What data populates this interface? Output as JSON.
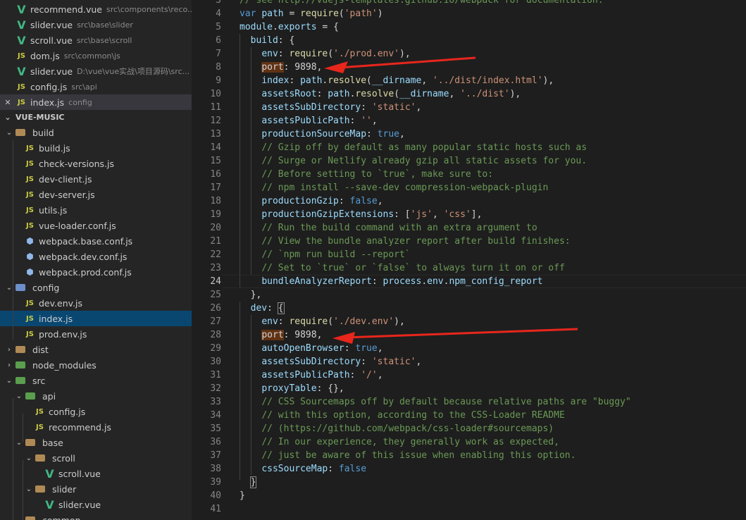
{
  "open_editors": [
    {
      "name": "recommend.vue",
      "path": "src\\components\\reco...",
      "type": "vue"
    },
    {
      "name": "slider.vue",
      "path": "src\\base\\slider",
      "type": "vue"
    },
    {
      "name": "scroll.vue",
      "path": "src\\base\\scroll",
      "type": "vue"
    },
    {
      "name": "dom.js",
      "path": "src\\common\\js",
      "type": "js"
    },
    {
      "name": "slider.vue",
      "path": "D:\\vue\\vue实战\\项目源码\\src...",
      "type": "vue"
    },
    {
      "name": "config.js",
      "path": "src\\api",
      "type": "js"
    },
    {
      "name": "index.js",
      "path": "config",
      "type": "js",
      "close": "✕",
      "selected": true
    }
  ],
  "project": {
    "title": "VUE-MUSIC",
    "chevron": "⌄"
  },
  "tree": [
    {
      "name": "build",
      "type": "folder",
      "depth": 0,
      "expanded": true,
      "color": "tan"
    },
    {
      "name": "build.js",
      "type": "js",
      "depth": 1
    },
    {
      "name": "check-versions.js",
      "type": "js",
      "depth": 1
    },
    {
      "name": "dev-client.js",
      "type": "js",
      "depth": 1
    },
    {
      "name": "dev-server.js",
      "type": "js",
      "depth": 1
    },
    {
      "name": "utils.js",
      "type": "js",
      "depth": 1
    },
    {
      "name": "vue-loader.conf.js",
      "type": "js",
      "depth": 1
    },
    {
      "name": "webpack.base.conf.js",
      "type": "webpack",
      "depth": 1
    },
    {
      "name": "webpack.dev.conf.js",
      "type": "webpack",
      "depth": 1
    },
    {
      "name": "webpack.prod.conf.js",
      "type": "webpack",
      "depth": 1
    },
    {
      "name": "config",
      "type": "folder",
      "depth": 0,
      "expanded": true,
      "color": "blue"
    },
    {
      "name": "dev.env.js",
      "type": "js",
      "depth": 1
    },
    {
      "name": "index.js",
      "type": "js",
      "depth": 1,
      "selected": true
    },
    {
      "name": "prod.env.js",
      "type": "js",
      "depth": 1
    },
    {
      "name": "dist",
      "type": "folder",
      "depth": 0,
      "expanded": false,
      "color": "tan"
    },
    {
      "name": "node_modules",
      "type": "folder",
      "depth": 0,
      "expanded": false,
      "color": "green"
    },
    {
      "name": "src",
      "type": "folder",
      "depth": 0,
      "expanded": true,
      "color": "green"
    },
    {
      "name": "api",
      "type": "folder",
      "depth": 1,
      "expanded": true,
      "color": "green"
    },
    {
      "name": "config.js",
      "type": "js",
      "depth": 2
    },
    {
      "name": "recommend.js",
      "type": "js",
      "depth": 2
    },
    {
      "name": "base",
      "type": "folder",
      "depth": 1,
      "expanded": true,
      "color": "tan"
    },
    {
      "name": "scroll",
      "type": "folder",
      "depth": 2,
      "expanded": true,
      "color": "tan"
    },
    {
      "name": "scroll.vue",
      "type": "vue",
      "depth": 3
    },
    {
      "name": "slider",
      "type": "folder",
      "depth": 2,
      "expanded": true,
      "color": "tan"
    },
    {
      "name": "slider.vue",
      "type": "vue",
      "depth": 3
    },
    {
      "name": "common",
      "type": "folder",
      "depth": 1,
      "expanded": true,
      "color": "tan"
    }
  ],
  "icons": {
    "js": "JS",
    "vue": "V",
    "webpack": "⬢",
    "folder_open": "⌄",
    "folder_closed": "›"
  },
  "code": {
    "first_line": 3,
    "active_line": 24,
    "lines": [
      [
        [
          "c",
          "// see http://vuejs-templates.github.io/webpack for documentation."
        ]
      ],
      [
        [
          "k",
          "var"
        ],
        [
          "t",
          " "
        ],
        [
          "p",
          "path"
        ],
        [
          "t",
          " = "
        ],
        [
          "f",
          "require"
        ],
        [
          "t",
          "("
        ],
        [
          "s",
          "'path'"
        ],
        [
          "t",
          ")"
        ]
      ],
      [
        [
          "p",
          "module"
        ],
        [
          "t",
          "."
        ],
        [
          "p",
          "exports"
        ],
        [
          "t",
          " = {"
        ]
      ],
      [
        [
          "t",
          "  "
        ],
        [
          "p",
          "build"
        ],
        [
          "t",
          ": {"
        ]
      ],
      [
        [
          "t",
          "    "
        ],
        [
          "p",
          "env"
        ],
        [
          "t",
          ": "
        ],
        [
          "f",
          "require"
        ],
        [
          "t",
          "("
        ],
        [
          "s",
          "'./prod.env'"
        ],
        [
          "t",
          "),"
        ]
      ],
      [
        [
          "t",
          "    "
        ],
        [
          "port",
          "port"
        ],
        [
          "t",
          ": 9898,"
        ]
      ],
      [
        [
          "t",
          "    "
        ],
        [
          "p",
          "index"
        ],
        [
          "t",
          ": "
        ],
        [
          "p",
          "path"
        ],
        [
          "t",
          "."
        ],
        [
          "f",
          "resolve"
        ],
        [
          "t",
          "("
        ],
        [
          "p",
          "__dirname"
        ],
        [
          "t",
          ", "
        ],
        [
          "s",
          "'../dist/index.html'"
        ],
        [
          "t",
          "),"
        ]
      ],
      [
        [
          "t",
          "    "
        ],
        [
          "p",
          "assetsRoot"
        ],
        [
          "t",
          ": "
        ],
        [
          "p",
          "path"
        ],
        [
          "t",
          "."
        ],
        [
          "f",
          "resolve"
        ],
        [
          "t",
          "("
        ],
        [
          "p",
          "__dirname"
        ],
        [
          "t",
          ", "
        ],
        [
          "s",
          "'../dist'"
        ],
        [
          "t",
          "),"
        ]
      ],
      [
        [
          "t",
          "    "
        ],
        [
          "p",
          "assetsSubDirectory"
        ],
        [
          "t",
          ": "
        ],
        [
          "s",
          "'static'"
        ],
        [
          "t",
          ","
        ]
      ],
      [
        [
          "t",
          "    "
        ],
        [
          "p",
          "assetsPublicPath"
        ],
        [
          "t",
          ": "
        ],
        [
          "s",
          "''"
        ],
        [
          "t",
          ","
        ]
      ],
      [
        [
          "t",
          "    "
        ],
        [
          "p",
          "productionSourceMap"
        ],
        [
          "t",
          ": "
        ],
        [
          "b",
          "true"
        ],
        [
          "t",
          ","
        ]
      ],
      [
        [
          "t",
          "    "
        ],
        [
          "c",
          "// Gzip off by default as many popular static hosts such as"
        ]
      ],
      [
        [
          "t",
          "    "
        ],
        [
          "c",
          "// Surge or Netlify already gzip all static assets for you."
        ]
      ],
      [
        [
          "t",
          "    "
        ],
        [
          "c",
          "// Before setting to `true`, make sure to:"
        ]
      ],
      [
        [
          "t",
          "    "
        ],
        [
          "c",
          "// npm install --save-dev compression-webpack-plugin"
        ]
      ],
      [
        [
          "t",
          "    "
        ],
        [
          "p",
          "productionGzip"
        ],
        [
          "t",
          ": "
        ],
        [
          "b",
          "false"
        ],
        [
          "t",
          ","
        ]
      ],
      [
        [
          "t",
          "    "
        ],
        [
          "p",
          "productionGzipExtensions"
        ],
        [
          "t",
          ": ["
        ],
        [
          "s",
          "'js'"
        ],
        [
          "t",
          ", "
        ],
        [
          "s",
          "'css'"
        ],
        [
          "t",
          "],"
        ]
      ],
      [
        [
          "t",
          "    "
        ],
        [
          "c",
          "// Run the build command with an extra argument to"
        ]
      ],
      [
        [
          "t",
          "    "
        ],
        [
          "c",
          "// View the bundle analyzer report after build finishes:"
        ]
      ],
      [
        [
          "t",
          "    "
        ],
        [
          "c",
          "// `npm run build --report`"
        ]
      ],
      [
        [
          "t",
          "    "
        ],
        [
          "c",
          "// Set to `true` or `false` to always turn it on or off"
        ]
      ],
      [
        [
          "t",
          "    "
        ],
        [
          "p",
          "bundleAnalyzerReport"
        ],
        [
          "t",
          ": "
        ],
        [
          "p",
          "process"
        ],
        [
          "t",
          "."
        ],
        [
          "p",
          "env"
        ],
        [
          "t",
          "."
        ],
        [
          "p",
          "npm_config_report"
        ]
      ],
      [
        [
          "t",
          "  },"
        ]
      ],
      [
        [
          "t",
          "  "
        ],
        [
          "p",
          "dev"
        ],
        [
          "t",
          ": "
        ],
        [
          "brk",
          "{"
        ]
      ],
      [
        [
          "t",
          "    "
        ],
        [
          "p",
          "env"
        ],
        [
          "t",
          ": "
        ],
        [
          "f",
          "require"
        ],
        [
          "t",
          "("
        ],
        [
          "s",
          "'./dev.env'"
        ],
        [
          "t",
          "),"
        ]
      ],
      [
        [
          "t",
          "    "
        ],
        [
          "port",
          "port"
        ],
        [
          "t",
          ": 9898,"
        ]
      ],
      [
        [
          "t",
          "    "
        ],
        [
          "p",
          "autoOpenBrowser"
        ],
        [
          "t",
          ": "
        ],
        [
          "b",
          "true"
        ],
        [
          "t",
          ","
        ]
      ],
      [
        [
          "t",
          "    "
        ],
        [
          "p",
          "assetsSubDirectory"
        ],
        [
          "t",
          ": "
        ],
        [
          "s",
          "'static'"
        ],
        [
          "t",
          ","
        ]
      ],
      [
        [
          "t",
          "    "
        ],
        [
          "p",
          "assetsPublicPath"
        ],
        [
          "t",
          ": "
        ],
        [
          "s",
          "'/'"
        ],
        [
          "t",
          ","
        ]
      ],
      [
        [
          "t",
          "    "
        ],
        [
          "p",
          "proxyTable"
        ],
        [
          "t",
          ": {},"
        ]
      ],
      [
        [
          "t",
          "    "
        ],
        [
          "c",
          "// CSS Sourcemaps off by default because relative paths are \"buggy\""
        ]
      ],
      [
        [
          "t",
          "    "
        ],
        [
          "c",
          "// with this option, according to the CSS-Loader README"
        ]
      ],
      [
        [
          "t",
          "    "
        ],
        [
          "c",
          "// (https://github.com/webpack/css-loader#sourcemaps)"
        ]
      ],
      [
        [
          "t",
          "    "
        ],
        [
          "c",
          "// In our experience, they generally work as expected,"
        ]
      ],
      [
        [
          "t",
          "    "
        ],
        [
          "c",
          "// just be aware of this issue when enabling this option."
        ]
      ],
      [
        [
          "t",
          "    "
        ],
        [
          "p",
          "cssSourceMap"
        ],
        [
          "t",
          ": "
        ],
        [
          "b",
          "false"
        ]
      ],
      [
        [
          "t",
          "  "
        ],
        [
          "brk",
          "}"
        ]
      ],
      [
        [
          "t",
          "}"
        ]
      ],
      [
        [
          "t",
          ""
        ]
      ]
    ]
  },
  "annotations": {
    "arrow_color": "#e8261c",
    "arrow_count": 2
  }
}
